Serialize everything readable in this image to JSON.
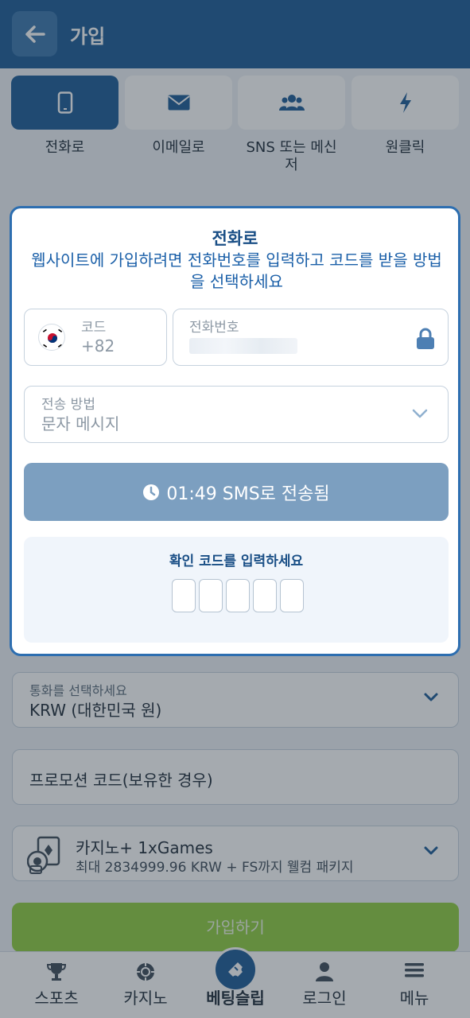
{
  "header": {
    "title": "가입"
  },
  "tabs": [
    {
      "label": "전화로",
      "icon": "phone-icon",
      "active": true
    },
    {
      "label": "이메일로",
      "icon": "mail-icon",
      "active": false
    },
    {
      "label": "SNS 또는 메신\n저",
      "icon": "users-icon",
      "active": false
    },
    {
      "label": "원클릭",
      "icon": "lightning-icon",
      "active": false
    }
  ],
  "modal": {
    "title": "전화로",
    "description": "웹사이트에 가입하려면 전화번호를 입력하고 코드를 받을 방법을 선택하세요",
    "code_label": "코드",
    "code_value": "+82",
    "phone_label": "전화번호",
    "method_label": "전송 방법",
    "method_value": "문자 메시지",
    "sms_status": "01:49 SMS로 전송됨",
    "verify_title": "확인 코드를 입력하세요",
    "digit_count": 5
  },
  "form": {
    "currency_label": "통화를 선택하세요",
    "currency_value": "KRW (대한민국 원)",
    "promo_placeholder": "프로모션 코드(보유한 경우)",
    "bonus_title": "카지노+ 1xGames",
    "bonus_sub": "최대 2834999.96 KRW + FS까지 웰컴 패키지",
    "register_label": "가입하기"
  },
  "bottom_nav": [
    {
      "label": "스포츠",
      "icon": "trophy-icon"
    },
    {
      "label": "카지노",
      "icon": "casino-chip-icon"
    },
    {
      "label": "베팅슬립",
      "icon": "ticket-icon"
    },
    {
      "label": "로그인",
      "icon": "user-icon"
    },
    {
      "label": "메뉴",
      "icon": "menu-icon"
    }
  ],
  "colors": {
    "brand": "#1a5a96",
    "accent_green": "#8fce3e",
    "modal_border": "#2d6eb0",
    "sms_button": "#7c9fc0"
  }
}
